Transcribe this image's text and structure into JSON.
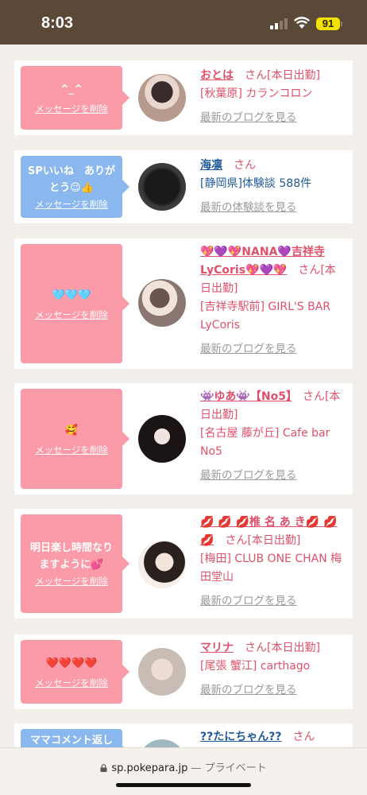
{
  "status_bar": {
    "time": "8:03",
    "battery": "91"
  },
  "cards": [
    {
      "message": "^_^",
      "delete_label": "メッセージを削除",
      "name": "おとは",
      "san": "さん",
      "badge": "[本日出勤]",
      "area": "[秋葉原] カランコロン",
      "link": "最新のブログを見る"
    },
    {
      "message": "SPいいね　ありがとう😉👍",
      "delete_label": "メッセージを削除",
      "name": "海凛",
      "san": "さん",
      "area": "[静岡県]体験談 588件",
      "link": "最新の体験談を見る"
    },
    {
      "message": "🩵🩵🩵",
      "delete_label": "メッセージを削除",
      "name": "💖💜💖NANA💜吉祥寺LyCoris💖💜💖",
      "san": "さん",
      "badge": "[本日出勤]",
      "area": "[吉祥寺駅前] GIRL'S BAR LyCoris",
      "link": "最新のブログを見る"
    },
    {
      "message": "🥰",
      "delete_label": "メッセージを削除",
      "name": "👾ゆあ👾【No5】",
      "san": "さん",
      "badge": "[本日出勤]",
      "area": "[名古屋 藤が丘] Cafe bar No5",
      "link": "最新のブログを見る"
    },
    {
      "message": "明日楽し時間なりますように💕",
      "delete_label": "メッセージを削除",
      "name": "💋 💋 💋椎 名 あ き💋 💋 💋",
      "san": "さん",
      "badge": "[本日出勤]",
      "area": "[梅田] CLUB ONE CHAN 梅田堂山",
      "link": "最新のブログを見る"
    },
    {
      "message": "❤️❤️❤️❤️",
      "delete_label": "メッセージを削除",
      "name": "マリナ",
      "san": "さん",
      "badge": "[本日出勤]",
      "area": "[尾張 蟹江] carthago",
      "link": "最新のブログを見る"
    },
    {
      "message": "ママコメント返し",
      "name": "??たにちゃん??",
      "san": "さん"
    }
  ],
  "browser": {
    "host": "sp.pokepara.jp",
    "separator": " — ",
    "mode": "プライベート"
  },
  "colors": {
    "pink": "#fb9aa8",
    "blue_bubble": "#8ab8ee",
    "name_pink": "#e0506a",
    "name_blue": "#1f5b9b"
  }
}
